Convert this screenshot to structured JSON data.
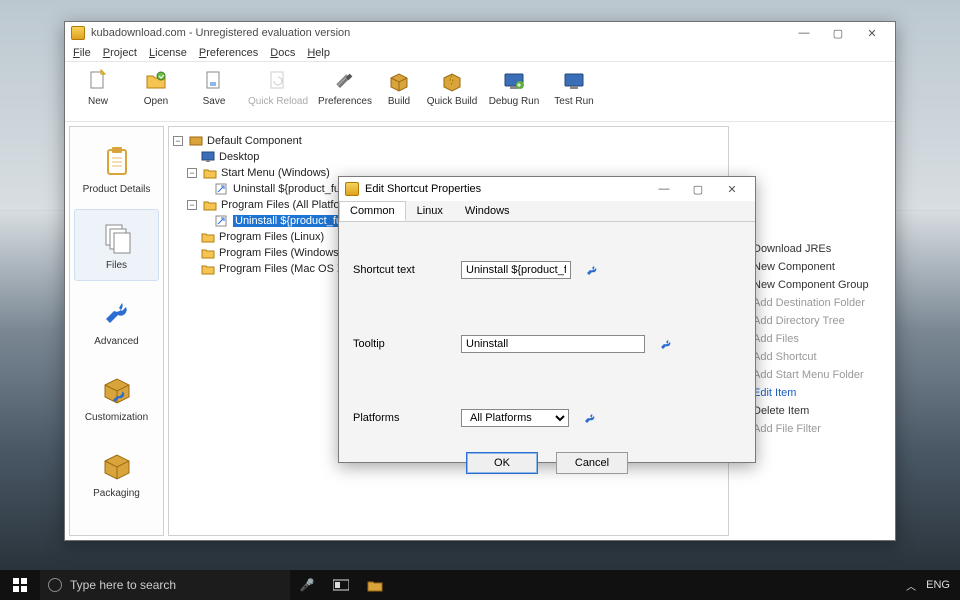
{
  "window": {
    "title": "kubadownload.com - Unregistered evaluation version",
    "menus": [
      "File",
      "Project",
      "License",
      "Preferences",
      "Docs",
      "Help"
    ],
    "controls": {
      "min": "—",
      "max": "▢",
      "close": "✕"
    }
  },
  "toolbar": [
    {
      "id": "new",
      "label": "New"
    },
    {
      "id": "open",
      "label": "Open"
    },
    {
      "id": "save",
      "label": "Save"
    },
    {
      "id": "quickreload",
      "label": "Quick Reload",
      "disabled": true
    },
    {
      "id": "preferences",
      "label": "Preferences"
    },
    {
      "id": "build",
      "label": "Build"
    },
    {
      "id": "quickbuild",
      "label": "Quick Build"
    },
    {
      "id": "debugrun",
      "label": "Debug Run"
    },
    {
      "id": "testrun",
      "label": "Test Run"
    }
  ],
  "sidebar": {
    "items": [
      {
        "id": "product-details",
        "label": "Product Details"
      },
      {
        "id": "files",
        "label": "Files",
        "selected": true
      },
      {
        "id": "advanced",
        "label": "Advanced"
      },
      {
        "id": "customization",
        "label": "Customization"
      },
      {
        "id": "packaging",
        "label": "Packaging"
      }
    ]
  },
  "tree": {
    "n0": "Default Component",
    "n1": "Desktop",
    "n2": "Start Menu (Windows)",
    "n3": "Uninstall ${product_fullname}",
    "n4": "Program Files (All Platforms)",
    "n5": "Uninstall ${product_fullname}",
    "n6": "Program Files (Linux)",
    "n7": "Program Files (Windows)",
    "n8": "Program Files (Mac OS X)"
  },
  "actions": {
    "download": "Download JREs",
    "newcomp": "New Component",
    "newgroup": "New Component Group",
    "adddest": "Add Destination Folder",
    "adddir": "Add Directory Tree",
    "addfiles": "Add Files",
    "addshort": "Add Shortcut",
    "addstart": "Add Start Menu Folder",
    "edit": "Edit Item",
    "delete": "Delete Item",
    "addfilter": "Add File Filter"
  },
  "dialog": {
    "title": "Edit Shortcut Properties",
    "tabs": [
      "Common",
      "Linux",
      "Windows"
    ],
    "labels": {
      "shortcut": "Shortcut text",
      "tooltip": "Tooltip",
      "platforms": "Platforms"
    },
    "values": {
      "shortcut": "Uninstall ${product_ful",
      "tooltip": "Uninstall",
      "platforms": "All Platforms"
    },
    "buttons": {
      "ok": "OK",
      "cancel": "Cancel"
    },
    "controls": {
      "min": "—",
      "max": "▢",
      "close": "✕"
    }
  },
  "taskbar": {
    "search_placeholder": "Type here to search",
    "lang": "ENG"
  }
}
